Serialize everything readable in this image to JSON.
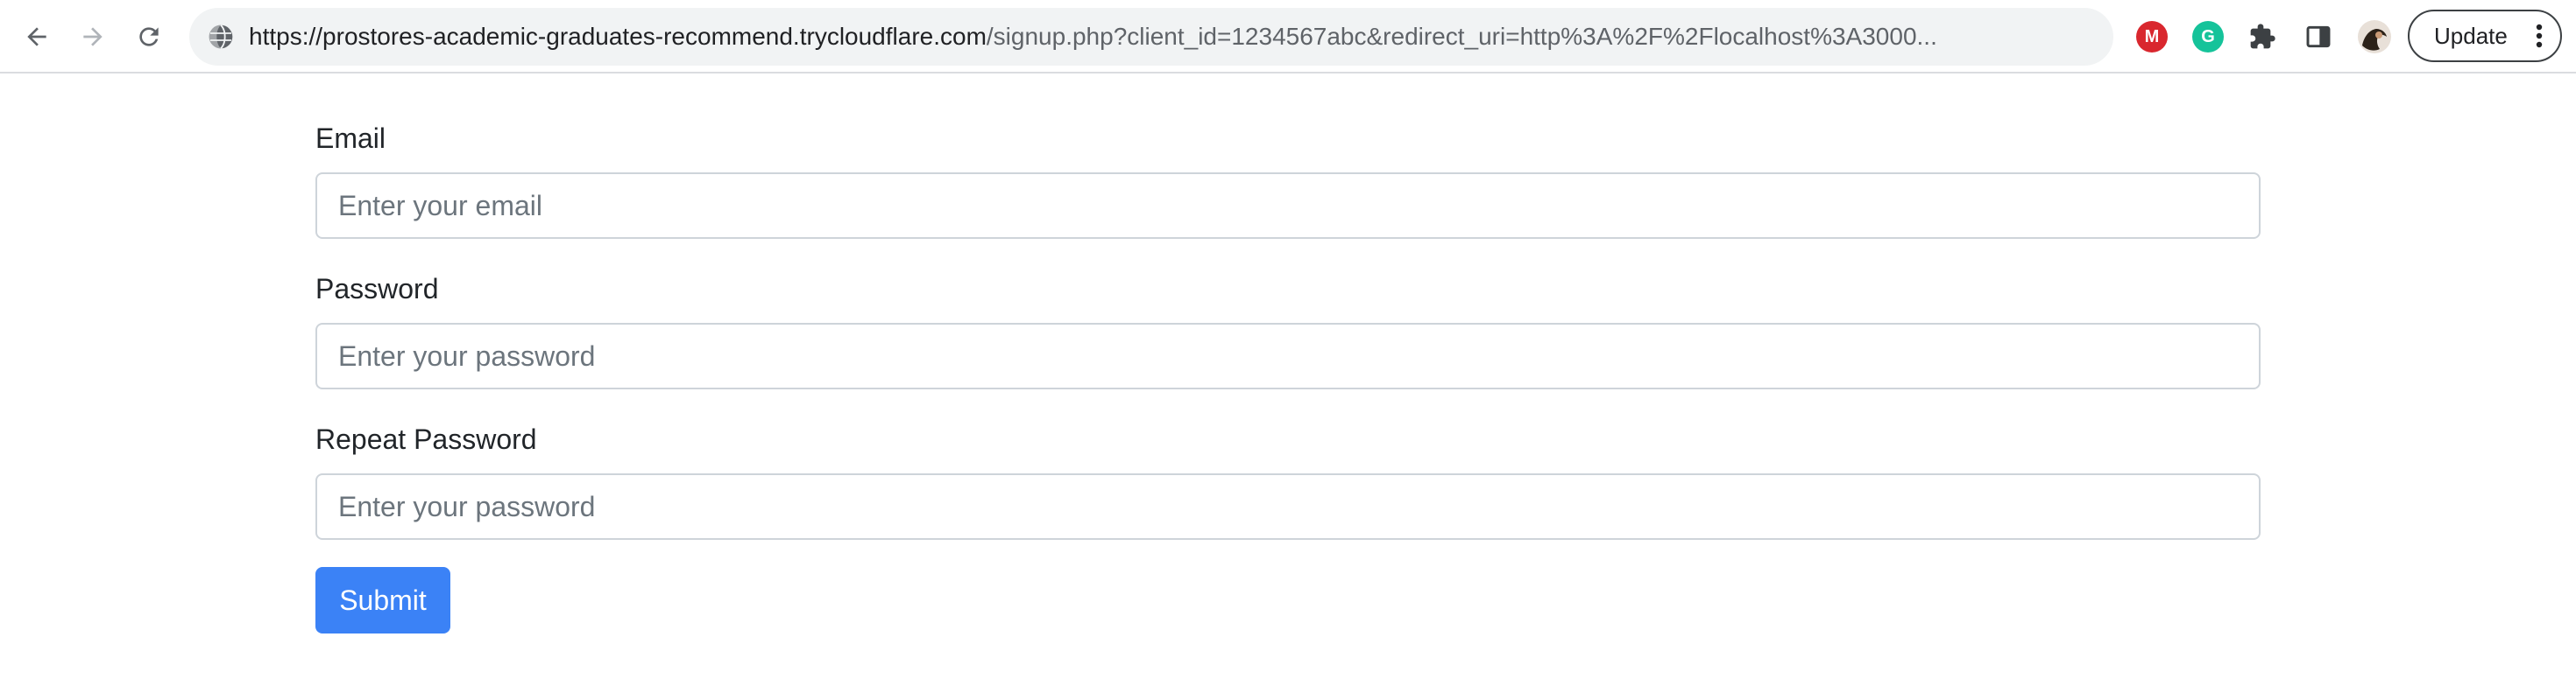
{
  "browser": {
    "url_host": "https://prostores-academic-graduates-recommend.trycloudflare.com",
    "url_path": "/signup.php?client_id=1234567abc&redirect_uri=http%3A%2F%2Flocalhost%3A3000...",
    "extensions": [
      {
        "name": "mega-extension",
        "letter": "M",
        "color": "#d9272e"
      },
      {
        "name": "grammarly-extension",
        "letter": "G",
        "color": "#15c39a"
      }
    ],
    "update_label": "Update"
  },
  "form": {
    "email_label": "Email",
    "email_placeholder": "Enter your email",
    "password_label": "Password",
    "password_placeholder": "Enter your password",
    "repeat_password_label": "Repeat Password",
    "repeat_password_placeholder": "Enter your password",
    "submit_label": "Submit"
  },
  "colors": {
    "primary": "#3b82f6",
    "input_border": "#ced4da",
    "placeholder": "#6c757d"
  }
}
